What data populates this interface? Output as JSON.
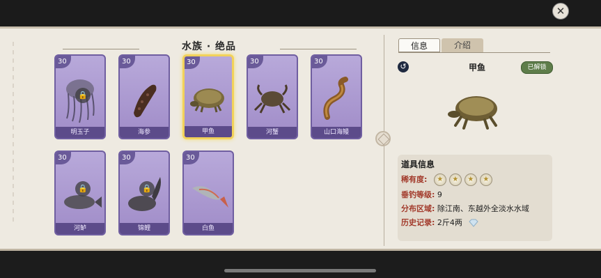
{
  "section_title": "水族 · 绝品",
  "cards": [
    {
      "level": "30",
      "name": "明玉子",
      "locked": true
    },
    {
      "level": "30",
      "name": "海参",
      "locked": false
    },
    {
      "level": "30",
      "name": "甲鱼",
      "locked": false,
      "selected": true
    },
    {
      "level": "30",
      "name": "河蟹",
      "locked": false
    },
    {
      "level": "30",
      "name": "山口海鳗",
      "locked": false
    },
    {
      "level": "30",
      "name": "河鲈",
      "locked": true
    },
    {
      "level": "30",
      "name": "锦鲤",
      "locked": true
    },
    {
      "level": "30",
      "name": "白鱼",
      "locked": false
    }
  ],
  "tabs": {
    "info": "信息",
    "intro": "介绍"
  },
  "detail": {
    "name": "甲鱼",
    "status": "已解锁",
    "props_title": "道具信息",
    "rarity_label": "稀有度:",
    "rarity_stars": 4,
    "level_label": "垂钓等级:",
    "level_value": "9",
    "area_label": "分布区域:",
    "area_value": "除江南、东越外全淡水水域",
    "record_label": "历史记录:",
    "record_value": "2斤4两"
  },
  "icons": {
    "close": "close-icon",
    "lock": "lock-icon",
    "back": "back-icon",
    "star": "star-icon",
    "diamond": "diamond-icon"
  },
  "colors": {
    "card_bg": "#a896d2",
    "selected_border": "#f2d25a",
    "label_red": "#a23a2b",
    "badge_green": "#5e7d4a"
  }
}
